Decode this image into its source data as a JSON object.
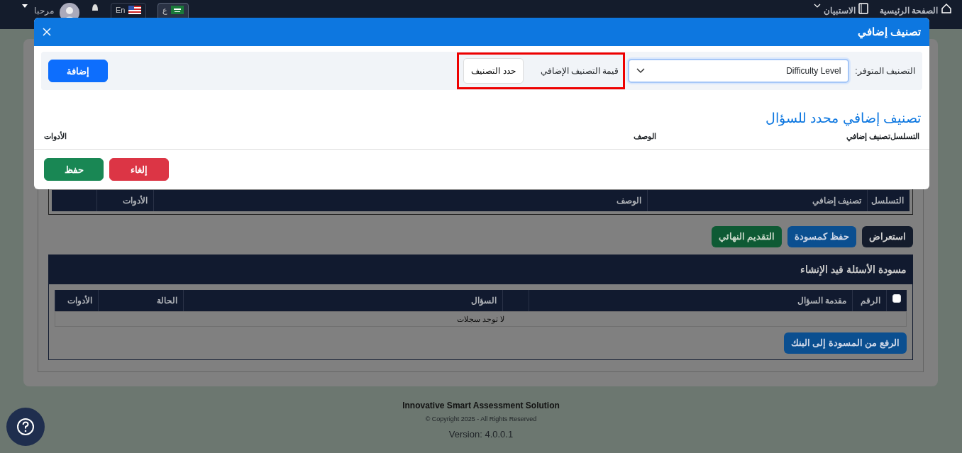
{
  "navbar": {
    "home": "الصفحة الرئيسية",
    "survey": "الاستبيان",
    "greeting": "مرحبا",
    "languages": [
      {
        "label": "ع",
        "selected": true
      },
      {
        "label": "En",
        "selected": false
      }
    ]
  },
  "background": {
    "classification_columns": [
      "التسلسل",
      "تصنيف إضافي",
      "الوصف",
      "الأدوات"
    ],
    "actions": [
      {
        "label": "استعراض",
        "kind": "dark"
      },
      {
        "label": "حفظ كمسودة",
        "kind": "primary"
      },
      {
        "label": "التقديم النهائي",
        "kind": "success"
      }
    ],
    "drafts": {
      "title": "مسودة الأسئلة قيد الإنشاء",
      "select_all_checked": false,
      "columns": [
        "الرقم",
        "مقدمة السؤال",
        "",
        "السؤال",
        "الحالة",
        "الأدوات"
      ],
      "empty": "لا توجد سجلات",
      "upload_button": "الرفع من المسودة إلى البنك"
    }
  },
  "modal": {
    "title": "تصنيف إضافي",
    "available_label": "التصنيف المتوفر:",
    "available_value": "Difficulty Level",
    "value_label": "قيمة التصنيف الإضافي",
    "value_button": "حدد التصنيف",
    "highlighted": true,
    "add_button": "إضافة",
    "section_title": "تصنيف إضافي محدد للسؤال",
    "columns": [
      "التسلسل",
      "تصنيف إضافي",
      "الوصف",
      "الأدوات"
    ],
    "buttons": [
      {
        "label": "إلغاء",
        "kind": "danger"
      },
      {
        "label": "حفظ",
        "kind": "success"
      }
    ]
  },
  "footer": {
    "company": "Innovative Smart Assessment Solution",
    "copyright": "Copyright 2025 - All Rights Reserved ©",
    "version": "Version: 4.0.0.1"
  }
}
